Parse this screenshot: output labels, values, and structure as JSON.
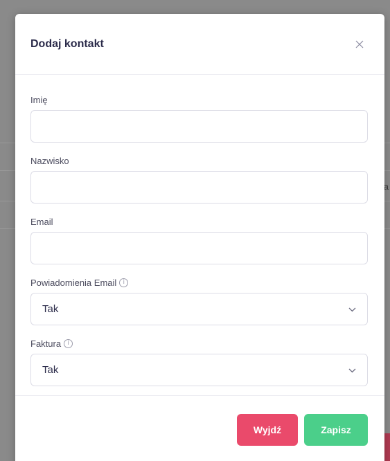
{
  "modal": {
    "title": "Dodaj kontakt",
    "close_icon": "close-icon"
  },
  "form": {
    "first_name": {
      "label": "Imię",
      "value": "",
      "placeholder": ""
    },
    "last_name": {
      "label": "Nazwisko",
      "value": "",
      "placeholder": ""
    },
    "email": {
      "label": "Email",
      "value": "",
      "placeholder": ""
    },
    "email_notifications": {
      "label": "Powiadomienia Email",
      "info_icon": "info-icon",
      "selected": "Tak"
    },
    "invoice": {
      "label": "Faktura",
      "info_icon": "info-icon",
      "selected": "Tak"
    }
  },
  "footer": {
    "exit_label": "Wyjdź",
    "save_label": "Zapisz"
  },
  "background_fragment": "a",
  "colors": {
    "exit_button": "#ea4a6b",
    "save_button": "#4bcf8a",
    "title_text": "#2b2b4a"
  }
}
